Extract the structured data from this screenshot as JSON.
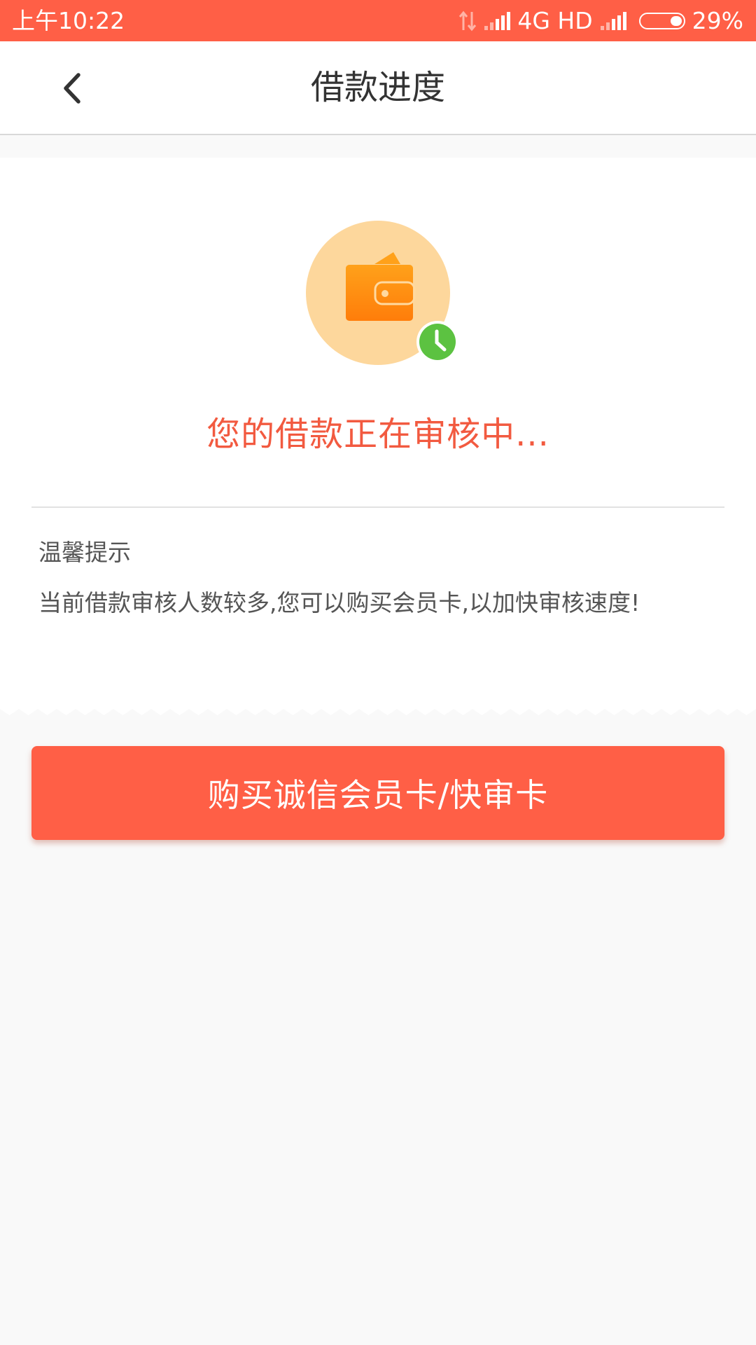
{
  "status_bar": {
    "time": "上午10:22",
    "network": "4G HD",
    "battery": "29%",
    "battery_level": 0.29
  },
  "header": {
    "title": "借款进度",
    "back_icon": "chevron-left-icon"
  },
  "status": {
    "icon": "wallet-icon",
    "badge_icon": "clock-icon",
    "message": "您的借款正在审核中..."
  },
  "tips": {
    "title": "温馨提示",
    "text": "当前借款审核人数较多,您可以购买会员卡,以加快审核速度!"
  },
  "action": {
    "buy_label": "购买诚信会员卡/快审卡"
  },
  "colors": {
    "accent": "#ff5f46",
    "message": "#f25a40",
    "wallet_bg": "#fdd79c",
    "wallet": "#ff8c00",
    "clock_badge": "#5cc241"
  }
}
